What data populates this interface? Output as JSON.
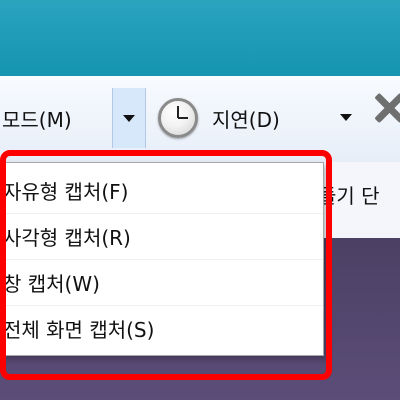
{
  "toolbar": {
    "mode_label": "모드(M)",
    "delay_label": "지연(D)"
  },
  "menu": {
    "items": [
      {
        "label": "자유형 캡처(F)"
      },
      {
        "label": "사각형 캡처(R)"
      },
      {
        "label": "창 캡처(W)"
      },
      {
        "label": "전체 화면 캡처(S)"
      }
    ]
  },
  "content": {
    "hint_text": "들기 단"
  },
  "colors": {
    "titlebar": "#1594b0",
    "highlight": "#ff0000"
  }
}
